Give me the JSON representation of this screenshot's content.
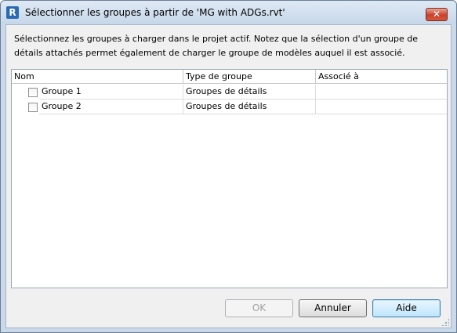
{
  "window": {
    "title": "Sélectionner les groupes à partir de 'MG with ADGs.rvt'",
    "app_icon": "revit-logo-icon",
    "close_label": "✕"
  },
  "instructions": "Sélectionnez les groupes à charger dans le projet actif. Notez que la sélection d'un groupe de détails attachés permet également de charger le groupe de modèles auquel il est associé.",
  "grid": {
    "columns": [
      "Nom",
      "Type de groupe",
      "Associé à"
    ],
    "rows": [
      {
        "name": "Groupe 1",
        "type": "Groupes de détails",
        "associated": "",
        "checked": false
      },
      {
        "name": "Groupe 2",
        "type": "Groupes de détails",
        "associated": "",
        "checked": false
      }
    ]
  },
  "buttons": {
    "ok": "OK",
    "cancel": "Annuler",
    "help": "Aide"
  },
  "colors": {
    "title_bar": "#c6d7ea",
    "close_button": "#c8412c",
    "dialog_bg": "#f0f0f0"
  }
}
